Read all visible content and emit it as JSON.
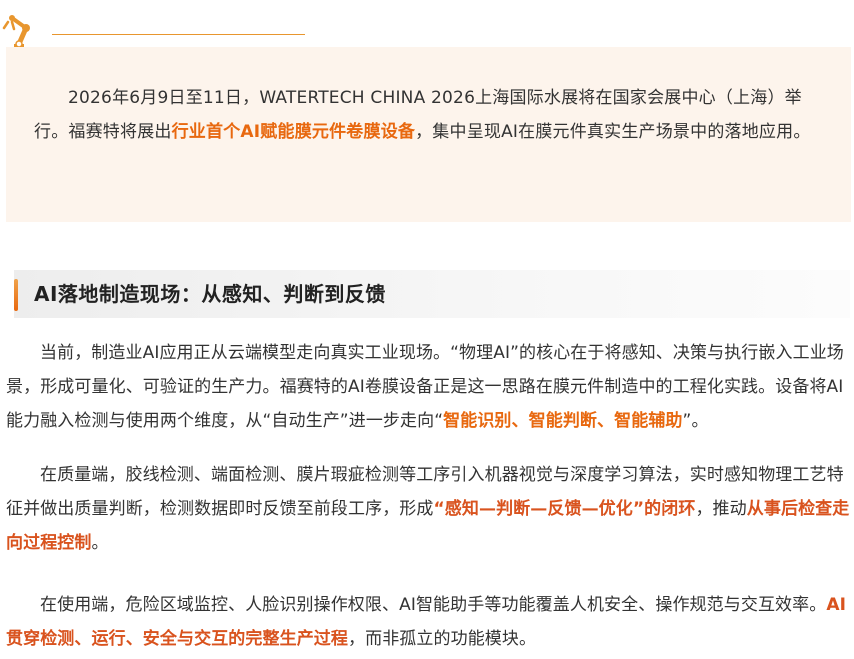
{
  "header": {
    "logo_icon": "industrial-robot-arm-icon",
    "accent_color": "#e8962e"
  },
  "intro": {
    "text_before": "2026年6月9日至11日，WATERTECH CHINA 2026上海国际水展将在国家会展中心（上海）举行。福赛特将展出",
    "highlight": "行业首个AI赋能膜元件卷膜设备",
    "text_after": "，集中呈现AI在膜元件真实生产场景中的落地应用。",
    "background_color": "#fdf4ec"
  },
  "section": {
    "title": "AI落地制造现场：从感知、判断到反馈",
    "bar_color": "#e8680f"
  },
  "paragraphs": {
    "p1": {
      "text_before": "当前，制造业AI应用正从云端模型走向真实工业现场。“物理AI”的核心在于将感知、决策与执行嵌入工业场景，形成可量化、可验证的生产力。福赛特的AI卷膜设备正是这一思路在膜元件制造中的工程化实践。设备将AI能力融入检测与使用两个维度，从“自动生产”进一步走向“",
      "highlight": "智能识别、智能判断、智能辅助",
      "text_after": "”。"
    },
    "p2": {
      "text_before": "在质量端，胶线检测、端面检测、膜片瑕疵检测等工序引入机器视觉与深度学习算法，实时感知物理工艺特征并做出质量判断，检测数据即时反馈至前段工序，形成",
      "highlight1": "“感知—判断—反馈—优化”的闭环",
      "text_middle": "，推动",
      "highlight2": "从事后检查走向过程控制",
      "text_after": "。"
    },
    "p3": {
      "text_before": "在使用端，危险区域监控、人脸识别操作权限、AI智能助手等功能覆盖人机安全、操作规范与交互效率。",
      "highlight": "AI贯穿检测、运行、安全与交互的完整生产过程",
      "text_after": "，而非孤立的功能模块。"
    }
  },
  "colors": {
    "highlight": "#e8680f",
    "highlight_strong": "#d9531e",
    "text": "#333333"
  }
}
